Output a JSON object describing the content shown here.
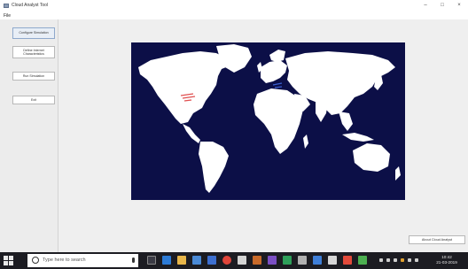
{
  "window": {
    "title": "Cloud Analyst Tool",
    "menu": [
      "File"
    ],
    "controls": {
      "minimize": "–",
      "maximize": "□",
      "close": "×"
    }
  },
  "sidebar": {
    "buttons": [
      {
        "label": "Configure Simulation",
        "active": true
      },
      {
        "label": "Define Internet Characteristics",
        "active": false
      },
      {
        "label": "Run Simulation",
        "active": false
      },
      {
        "label": "Exit",
        "active": false
      }
    ]
  },
  "main": {
    "map": {
      "background": "#0c0f47",
      "land_color": "#ffffff",
      "markers": [
        {
          "name": "north-america-region",
          "color": "#e05050"
        },
        {
          "name": "europe-region",
          "color": "#3a5fd0"
        }
      ]
    },
    "about_button": "About Cloud Analyst"
  },
  "taskbar": {
    "search_placeholder": "Type here to search",
    "icons": [
      "task-view-icon",
      "edge-icon",
      "file-explorer-icon",
      "store-icon",
      "mail-icon",
      "chrome-icon",
      "app-icon",
      "app-icon",
      "app-icon",
      "app-icon",
      "app-icon",
      "app-icon",
      "app-icon",
      "java-icon",
      "app-icon"
    ],
    "clock_time": "10:42",
    "clock_date": "21-03-2019"
  },
  "colors": {
    "accent_btn_border": "#8fa9cc",
    "taskbar": "#1c1c22"
  }
}
